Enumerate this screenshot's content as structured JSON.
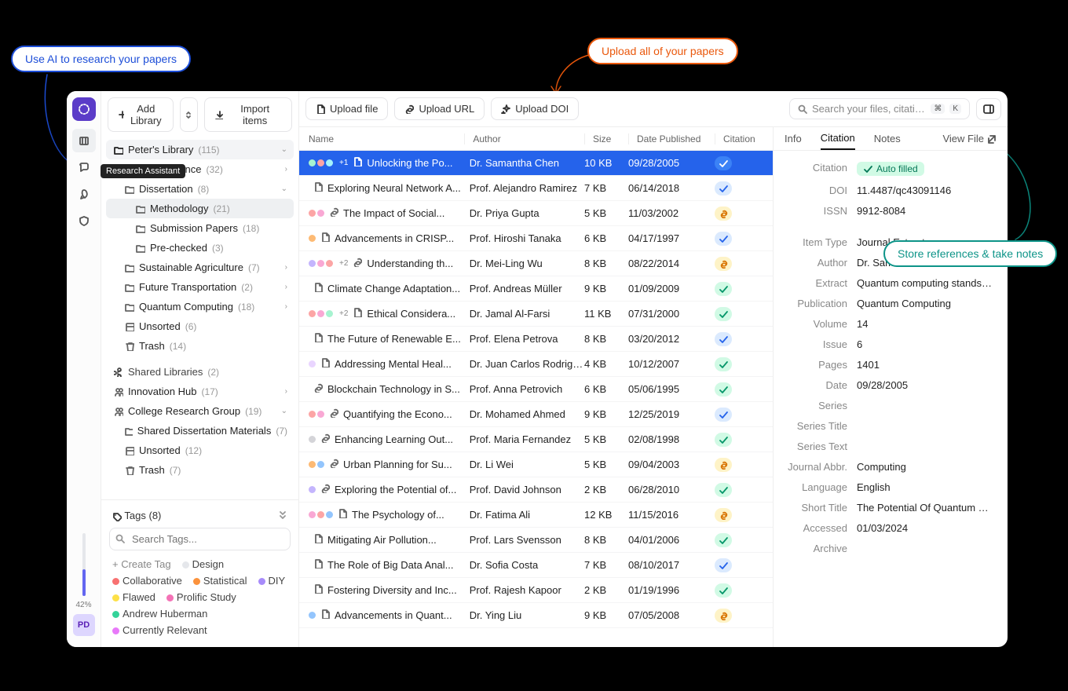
{
  "callouts": {
    "left": "Use AI to research your papers",
    "top": "Upload all of your papers",
    "right": "Store references & take notes"
  },
  "rail": {
    "tooltip": "Research Assistant",
    "gauge_pct": "42%",
    "avatar": "PD"
  },
  "sidebar": {
    "add_library": "Add Library",
    "import_items": "Import items",
    "root": {
      "label": "Peter's Library",
      "count": "(115)"
    },
    "nodes": [
      {
        "lvl": 2,
        "ico": "folder",
        "label": "Neuroscience",
        "count": "(32)",
        "chev": "›"
      },
      {
        "lvl": 2,
        "ico": "folder",
        "label": "Dissertation",
        "count": "(8)",
        "chev": "⌄"
      },
      {
        "lvl": 3,
        "ico": "folder",
        "label": "Methodology",
        "count": "(21)",
        "selected": true
      },
      {
        "lvl": 3,
        "ico": "folder",
        "label": "Submission Papers",
        "count": "(18)"
      },
      {
        "lvl": 3,
        "ico": "folder",
        "label": "Pre-checked",
        "count": "(3)"
      },
      {
        "lvl": 2,
        "ico": "folder",
        "label": "Sustainable Agriculture",
        "count": "(7)",
        "chev": "›"
      },
      {
        "lvl": 2,
        "ico": "folder",
        "label": "Future Transportation",
        "count": "(2)",
        "chev": "›"
      },
      {
        "lvl": 2,
        "ico": "folder",
        "label": "Quantum Computing",
        "count": "(18)",
        "chev": "›"
      },
      {
        "lvl": 2,
        "ico": "unsorted",
        "label": "Unsorted",
        "count": "(6)"
      },
      {
        "lvl": 2,
        "ico": "trash",
        "label": "Trash",
        "count": "(14)"
      }
    ],
    "shared_label": "Shared Libraries",
    "shared_count": "(2)",
    "shared": [
      {
        "lvl": 1,
        "ico": "group",
        "label": "Innovation Hub",
        "count": "(17)",
        "chev": "›"
      },
      {
        "lvl": 1,
        "ico": "group",
        "label": "College Research Group",
        "count": "(19)",
        "chev": "⌄"
      },
      {
        "lvl": 2,
        "ico": "folder",
        "label": "Shared Dissertation Materials",
        "count": "(7)"
      },
      {
        "lvl": 2,
        "ico": "unsorted",
        "label": "Unsorted",
        "count": "(12)"
      },
      {
        "lvl": 2,
        "ico": "trash",
        "label": "Trash",
        "count": "(7)"
      }
    ],
    "tags_label": "Tags",
    "tags_count": "(8)",
    "tags_search_ph": "Search Tags...",
    "create_tag": "Create Tag",
    "tags": [
      {
        "c": "#e5e7eb",
        "t": "Design"
      },
      {
        "c": "#f87171",
        "t": "Collaborative"
      },
      {
        "c": "#fb923c",
        "t": "Statistical"
      },
      {
        "c": "#a78bfa",
        "t": "DIY"
      },
      {
        "c": "#fde047",
        "t": "Flawed"
      },
      {
        "c": "#f472b6",
        "t": "Prolific Study"
      },
      {
        "c": "#34d399",
        "t": "Andrew Huberman"
      },
      {
        "c": "#e879f9",
        "t": "Currently Relevant"
      }
    ]
  },
  "toolbar": {
    "upload_file": "Upload file",
    "upload_url": "Upload URL",
    "upload_doi": "Upload DOI",
    "search_ph": "Search your files, citations, notes, ...",
    "kbd1": "⌘",
    "kbd2": "K"
  },
  "columns": {
    "name": "Name",
    "author": "Author",
    "size": "Size",
    "date": "Date Published",
    "citation": "Citation"
  },
  "rows": [
    {
      "dots": [
        "#a7f3d0",
        "#fca5a5",
        "#a5f3fc"
      ],
      "plus": "+1",
      "ico": "file",
      "name": "Unlocking the Po...",
      "author": "Dr. Samantha Chen",
      "size": "10 KB",
      "date": "09/28/2005",
      "pill": "sel",
      "selected": true
    },
    {
      "dots": [],
      "ico": "file",
      "name": "Exploring Neural Network A...",
      "author": "Prof. Alejandro Ramirez",
      "size": "7 KB",
      "date": "06/14/2018",
      "pill": "blue"
    },
    {
      "dots": [
        "#fca5a5",
        "#f9a8d4"
      ],
      "ico": "link",
      "name": "The Impact of Social...",
      "author": "Dr. Priya Gupta",
      "size": "5 KB",
      "date": "11/03/2002",
      "pill": "amber"
    },
    {
      "dots": [
        "#fdba74"
      ],
      "ico": "file",
      "name": "Advancements in CRISP...",
      "author": "Prof. Hiroshi Tanaka",
      "size": "6 KB",
      "date": "04/17/1997",
      "pill": "blue"
    },
    {
      "dots": [
        "#c4b5fd",
        "#f9a8d4",
        "#fca5a5"
      ],
      "plus": "+2",
      "ico": "link",
      "name": "Understanding th...",
      "author": "Dr. Mei-Ling Wu",
      "size": "8 KB",
      "date": "08/22/2014",
      "pill": "amber"
    },
    {
      "dots": [],
      "ico": "file",
      "name": "Climate Change Adaptation...",
      "author": "Prof. Andreas Müller",
      "size": "9 KB",
      "date": "01/09/2009",
      "pill": "green"
    },
    {
      "dots": [
        "#fca5a5",
        "#f9a8d4",
        "#a7f3d0"
      ],
      "plus": "+2",
      "ico": "file",
      "name": "Ethical Considera...",
      "author": "Dr. Jamal Al-Farsi",
      "size": "11 KB",
      "date": "07/31/2000",
      "pill": "green"
    },
    {
      "dots": [],
      "ico": "file",
      "name": "The Future of Renewable E...",
      "author": "Prof. Elena Petrova",
      "size": "8 KB",
      "date": "03/20/2012",
      "pill": "blue"
    },
    {
      "dots": [
        "#e9d5ff"
      ],
      "ico": "file",
      "name": "Addressing Mental Heal...",
      "author": "Dr. Juan Carlos Rodriguez",
      "size": "4 KB",
      "date": "10/12/2007",
      "pill": "green"
    },
    {
      "dots": [],
      "ico": "link",
      "name": "Blockchain Technology in S...",
      "author": "Prof. Anna Petrovich",
      "size": "6 KB",
      "date": "05/06/1995",
      "pill": "green"
    },
    {
      "dots": [
        "#fca5a5",
        "#f9a8d4"
      ],
      "ico": "link",
      "name": "Quantifying the Econo...",
      "author": "Dr. Mohamed Ahmed",
      "size": "9 KB",
      "date": "12/25/2019",
      "pill": "blue"
    },
    {
      "dots": [
        "#d4d4d8"
      ],
      "ico": "link",
      "name": "Enhancing Learning Out...",
      "author": "Prof. Maria Fernandez",
      "size": "5 KB",
      "date": "02/08/1998",
      "pill": "green"
    },
    {
      "dots": [
        "#fdba74",
        "#93c5fd"
      ],
      "ico": "link",
      "name": "Urban Planning for Su...",
      "author": "Dr. Li Wei",
      "size": "5 KB",
      "date": "09/04/2003",
      "pill": "amber"
    },
    {
      "dots": [
        "#c4b5fd"
      ],
      "ico": "link",
      "name": "Exploring the Potential of...",
      "author": "Prof. David Johnson",
      "size": "2 KB",
      "date": "06/28/2010",
      "pill": "green"
    },
    {
      "dots": [
        "#f9a8d4",
        "#fca5a5",
        "#93c5fd"
      ],
      "ico": "file",
      "name": "The Psychology of...",
      "author": "Dr. Fatima Ali",
      "size": "12 KB",
      "date": "11/15/2016",
      "pill": "amber"
    },
    {
      "dots": [],
      "ico": "file",
      "name": "Mitigating Air Pollution...",
      "author": "Prof. Lars Svensson",
      "size": "8 KB",
      "date": "04/01/2006",
      "pill": "green"
    },
    {
      "dots": [],
      "ico": "file",
      "name": "The Role of Big Data Anal...",
      "author": "Dr. Sofia Costa",
      "size": "7 KB",
      "date": "08/10/2017",
      "pill": "blue"
    },
    {
      "dots": [],
      "ico": "file",
      "name": "Fostering Diversity and Inc...",
      "author": "Prof. Rajesh Kapoor",
      "size": "2 KB",
      "date": "01/19/1996",
      "pill": "green"
    },
    {
      "dots": [
        "#93c5fd"
      ],
      "ico": "file",
      "name": "Advancements in Quant...",
      "author": "Dr. Ying Liu",
      "size": "9 KB",
      "date": "07/05/2008",
      "pill": "amber"
    }
  ],
  "details": {
    "tabs": {
      "info": "Info",
      "citation": "Citation",
      "notes": "Notes",
      "view": "View File"
    },
    "head": [
      {
        "l": "Citation",
        "v": "Auto filled",
        "auto": true
      },
      {
        "l": "DOI",
        "v": "11.4487/qc43091146"
      },
      {
        "l": "ISSN",
        "v": "9912-8084"
      }
    ],
    "meta": [
      {
        "l": "Item Type",
        "v": "Journal Extract"
      },
      {
        "l": "Author",
        "v": "Dr. Samantha Chen"
      },
      {
        "l": "Extract",
        "v": "Quantum computing stands at..."
      },
      {
        "l": "Publication",
        "v": "Quantum Computing"
      },
      {
        "l": "Volume",
        "v": "14"
      },
      {
        "l": "Issue",
        "v": "6"
      },
      {
        "l": "Pages",
        "v": "1401"
      },
      {
        "l": "Date",
        "v": "09/28/2005"
      },
      {
        "l": "Series",
        "v": ""
      },
      {
        "l": "Series Title",
        "v": ""
      },
      {
        "l": "Series Text",
        "v": ""
      },
      {
        "l": "Journal Abbr.",
        "v": "Computing"
      },
      {
        "l": "Language",
        "v": "English"
      },
      {
        "l": "Short Title",
        "v": "The Potential Of Quantum Co..."
      },
      {
        "l": "Accessed",
        "v": "01/03/2024"
      },
      {
        "l": "Archive",
        "v": ""
      }
    ]
  }
}
